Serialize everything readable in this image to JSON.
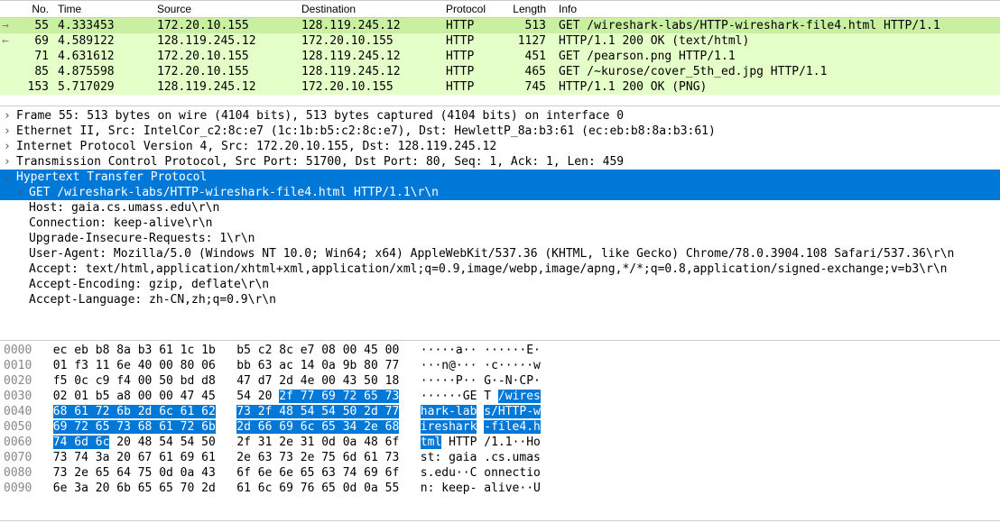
{
  "columns": {
    "no": "No.",
    "time": "Time",
    "src": "Source",
    "dst": "Destination",
    "proto": "Protocol",
    "len": "Length",
    "info": "Info"
  },
  "packets": [
    {
      "arrow": "→",
      "no": "55",
      "time": "4.333453",
      "src": "172.20.10.155",
      "dst": "128.119.245.12",
      "proto": "HTTP",
      "len": "513",
      "info": "GET /wireshark-labs/HTTP-wireshark-file4.html HTTP/1.1",
      "sel": true
    },
    {
      "arrow": "←",
      "no": "69",
      "time": "4.589122",
      "src": "128.119.245.12",
      "dst": "172.20.10.155",
      "proto": "HTTP",
      "len": "1127",
      "info": "HTTP/1.1 200 OK  (text/html)",
      "sel": false
    },
    {
      "arrow": "",
      "no": "71",
      "time": "4.631612",
      "src": "172.20.10.155",
      "dst": "128.119.245.12",
      "proto": "HTTP",
      "len": "451",
      "info": "GET /pearson.png HTTP/1.1",
      "sel": false
    },
    {
      "arrow": "",
      "no": "85",
      "time": "4.875598",
      "src": "172.20.10.155",
      "dst": "128.119.245.12",
      "proto": "HTTP",
      "len": "465",
      "info": "GET /~kurose/cover_5th_ed.jpg HTTP/1.1",
      "sel": false
    },
    {
      "arrow": "",
      "no": "153",
      "time": "5.717029",
      "src": "128.119.245.12",
      "dst": "172.20.10.155",
      "proto": "HTTP",
      "len": "745",
      "info": "HTTP/1.1 200 OK  (PNG)",
      "sel": false
    }
  ],
  "details": {
    "frame": "Frame 55: 513 bytes on wire (4104 bits), 513 bytes captured (4104 bits) on interface 0",
    "eth": "Ethernet II, Src: IntelCor_c2:8c:e7 (1c:1b:b5:c2:8c:e7), Dst: HewlettP_8a:b3:61 (ec:eb:b8:8a:b3:61)",
    "ip": "Internet Protocol Version 4, Src: 172.20.10.155, Dst: 128.119.245.12",
    "tcp": "Transmission Control Protocol, Src Port: 51700, Dst Port: 80, Seq: 1, Ack: 1, Len: 459",
    "http": "Hypertext Transfer Protocol",
    "req": "GET /wireshark-labs/HTTP-wireshark-file4.html HTTP/1.1\\r\\n",
    "host": "Host: gaia.cs.umass.edu\\r\\n",
    "conn": "Connection: keep-alive\\r\\n",
    "uir": "Upgrade-Insecure-Requests: 1\\r\\n",
    "ua": "User-Agent: Mozilla/5.0 (Windows NT 10.0; Win64; x64) AppleWebKit/537.36 (KHTML, like Gecko) Chrome/78.0.3904.108 Safari/537.36\\r\\n",
    "accept": "Accept: text/html,application/xhtml+xml,application/xml;q=0.9,image/webp,image/apng,*/*;q=0.8,application/signed-exchange;v=b3\\r\\n",
    "accenc": "Accept-Encoding: gzip, deflate\\r\\n",
    "acclang": "Accept-Language: zh-CN,zh;q=0.9\\r\\n"
  },
  "hex": [
    {
      "off": "0000",
      "b1": "ec eb b8 8a b3 61 1c 1b",
      "b2": "b5 c2 8c e7 08 00 45 00",
      "a1": "·····a··",
      "a2": " ······E·"
    },
    {
      "off": "0010",
      "b1": "01 f3 11 6e 40 00 80 06",
      "b2": "bb 63 ac 14 0a 9b 80 77",
      "a1": "···n@···",
      "a2": " ·c·····w"
    },
    {
      "off": "0020",
      "b1": "f5 0c c9 f4 00 50 bd d8",
      "b2": "47 d7 2d 4e 00 43 50 18",
      "a1": "·····P··",
      "a2": " G·-N·CP·"
    },
    {
      "off": "0030",
      "b1": "02 01 b5 a8 00 00 47 45",
      "b2p": "54 20 ",
      "b2h": "2f 77 69 72 65 73",
      "a1": "······GE",
      "a2p": " T ",
      "a2h": "/wires"
    },
    {
      "off": "0040",
      "b1h": "68 61 72 6b 2d 6c 61 62",
      "b2h": "73 2f 48 54 54 50 2d 77",
      "a1h": "hark-lab",
      "a2p": " ",
      "a2h": "s/HTTP-w"
    },
    {
      "off": "0050",
      "b1h": "69 72 65 73 68 61 72 6b",
      "b2h": "2d 66 69 6c 65 34 2e 68",
      "a1h": "ireshark",
      "a2p": " ",
      "a2h": "-file4.h"
    },
    {
      "off": "0060",
      "b1h": "74 6d 6c",
      "b1p": " 20 48 54 54 50",
      "b2": "2f 31 2e 31 0d 0a 48 6f",
      "a1h": "tml",
      "a1p": " HTTP",
      "a2": " /1.1··Ho"
    },
    {
      "off": "0070",
      "b1": "73 74 3a 20 67 61 69 61",
      "b2": "2e 63 73 2e 75 6d 61 73",
      "a1": "st: gaia",
      "a2": " .cs.umas"
    },
    {
      "off": "0080",
      "b1": "73 2e 65 64 75 0d 0a 43",
      "b2": "6f 6e 6e 65 63 74 69 6f",
      "a1": "s.edu··C",
      "a2": " onnectio"
    },
    {
      "off": "0090",
      "b1": "6e 3a 20 6b 65 65 70 2d",
      "b2": "61 6c 69 76 65 0d 0a 55",
      "a1": "n: keep-",
      "a2": " alive··U"
    }
  ]
}
